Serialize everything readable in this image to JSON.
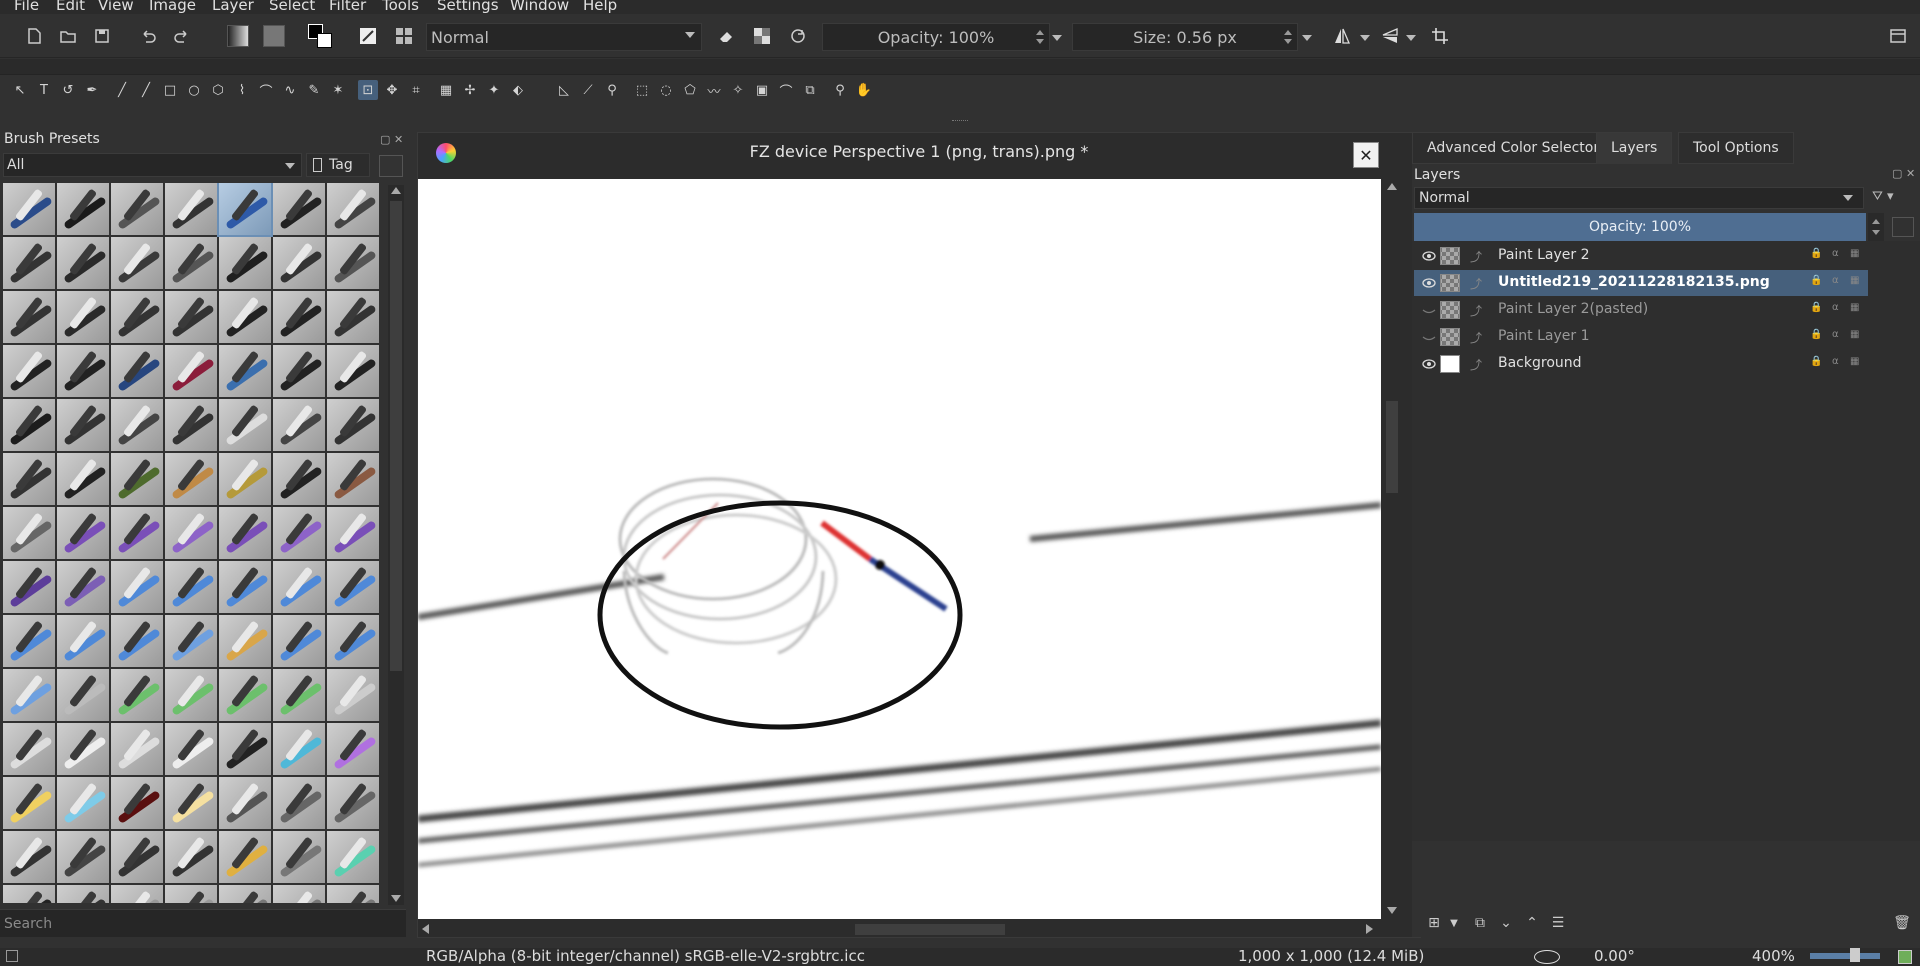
{
  "menu": [
    "File",
    "Edit",
    "View",
    "Image",
    "Layer",
    "Select",
    "Filter",
    "Tools",
    "Settings",
    "Window",
    "Help"
  ],
  "toolbar": {
    "blend_mode": "Normal",
    "opacity": "Opacity: 100%",
    "size": "Size: 0.56 px"
  },
  "brush_presets": {
    "title": "Brush Presets",
    "filter": "All",
    "tag": "Tag",
    "search_placeholder": "Search"
  },
  "document": {
    "title": "FZ device Perspective 1 (png, trans).png *"
  },
  "right_tabs": [
    "Advanced Color Selector",
    "Layers",
    "Tool Options"
  ],
  "layers": {
    "title": "Layers",
    "blend_mode": "Normal",
    "opacity": "Opacity:  100%",
    "items": [
      {
        "name": "Paint Layer 2",
        "visible": true,
        "active": false
      },
      {
        "name": "Untitled219_20211228182135.png",
        "visible": true,
        "active": true
      },
      {
        "name": "Paint Layer 2(pasted)",
        "visible": false,
        "active": false
      },
      {
        "name": "Paint Layer 1",
        "visible": false,
        "active": false
      },
      {
        "name": "Background",
        "visible": true,
        "active": false
      }
    ]
  },
  "status": {
    "color_space": "RGB/Alpha (8-bit integer/channel)  sRGB-elle-V2-srgbtrc.icc",
    "image_size": "1,000 x 1,000 (12.4 MiB)",
    "rotation": "0.00°",
    "zoom": "400%"
  }
}
